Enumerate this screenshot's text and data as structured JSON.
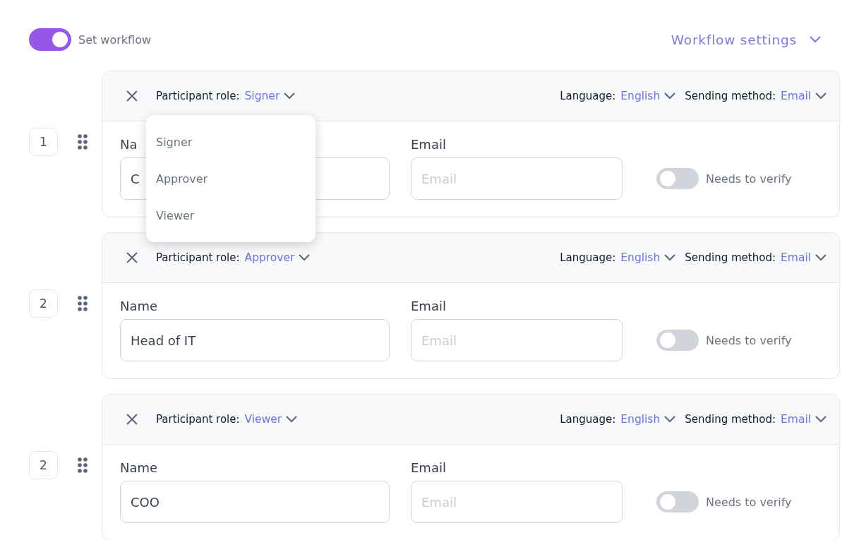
{
  "workflow": {
    "label": "Set workflow",
    "on": true
  },
  "settings_link": {
    "label": "Workflow settings"
  },
  "participants": [
    {
      "number": "1",
      "role_label": "Participant role:",
      "role": "Signer",
      "language_label": "Language:",
      "language": "English",
      "sending_label": "Sending method:",
      "sending": "Email",
      "name_label": "Na",
      "name_value": "C",
      "email_label": "Email",
      "email_placeholder": "Email",
      "verify_label": "Needs to verify",
      "verify_on": false,
      "menu": {
        "items": [
          {
            "label": "Signer",
            "selected": false
          },
          {
            "label": "Approver",
            "selected": false
          },
          {
            "label": "Viewer",
            "selected": false
          }
        ]
      }
    },
    {
      "number": "2",
      "role_label": "Participant role:",
      "role": "Approver",
      "language_label": "Language:",
      "language": "English",
      "sending_label": "Sending method:",
      "sending": "Email",
      "name_label": "Name",
      "name_value": "Head of IT",
      "email_label": "Email",
      "email_placeholder": "Email",
      "verify_label": "Needs to verify",
      "verify_on": false
    },
    {
      "number": "2",
      "role_label": "Participant role:",
      "role": "Viewer",
      "language_label": "Language:",
      "language": "English",
      "sending_label": "Sending method:",
      "sending": "Email",
      "name_label": "Name",
      "name_value": "COO",
      "email_label": "Email",
      "email_placeholder": "Email",
      "verify_label": "Needs to verify",
      "verify_on": false
    }
  ]
}
